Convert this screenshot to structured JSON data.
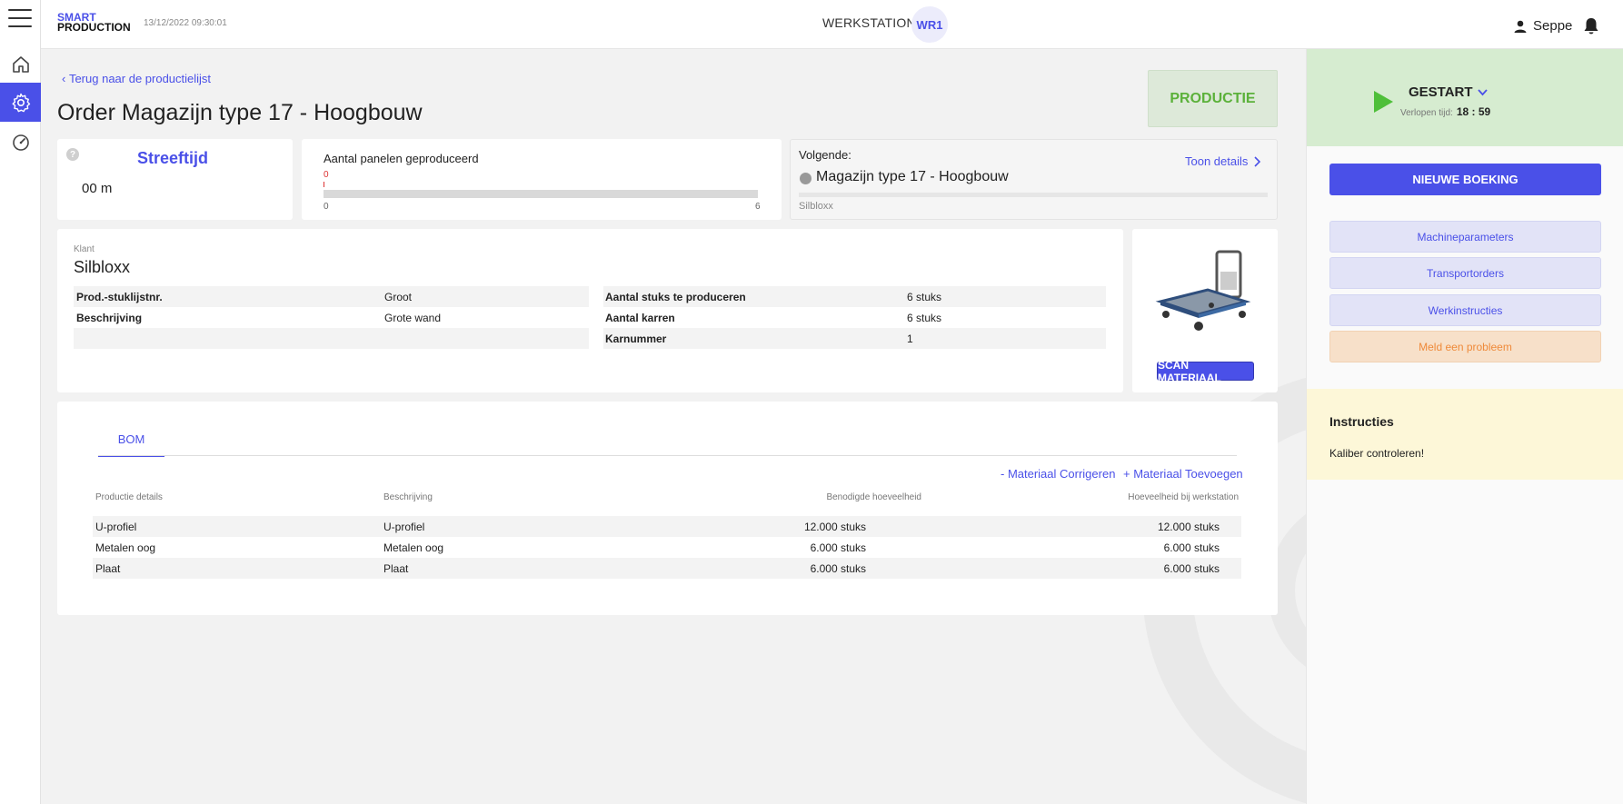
{
  "header": {
    "logo_line1": "SMART",
    "logo_line2": "PRODUCTION",
    "timestamp": "13/12/2022 09:30:01",
    "workstation_label": "WERKSTATION",
    "workstation_code": "WR1",
    "user_name": "Seppe"
  },
  "nav": {
    "items": [
      "home-icon",
      "gear-icon",
      "dashboard-icon"
    ],
    "active": 1
  },
  "main": {
    "back_link": "Terug naar de productielijst",
    "title": "Order Magazijn type 17 - Hoogbouw",
    "status_badge": "PRODUCTIE",
    "streeftijd": {
      "question": "?",
      "label": "Streeftijd",
      "value": "00 m"
    },
    "panels": {
      "label": "Aantal panelen geproduceerd",
      "current": "0",
      "min": "0",
      "max": "6",
      "progress": 0
    },
    "next": {
      "label": "Volgende:",
      "name": "Magazijn type 17 - Hoogbouw",
      "customer": "Silbloxx",
      "details_link": "Toon details"
    },
    "info": {
      "customer_label": "Klant",
      "customer": "Silbloxx",
      "left_rows": [
        {
          "key": "Prod.-stuklijstnr.",
          "value": "Groot"
        },
        {
          "key": "Beschrijving",
          "value": "Grote wand"
        },
        {
          "key": "",
          "value": ""
        }
      ],
      "right_rows": [
        {
          "key": "Aantal stuks te produceren",
          "value": "6 stuks"
        },
        {
          "key": "Aantal karren",
          "value": "6 stuks"
        },
        {
          "key": "Karnummer",
          "value": "1"
        }
      ]
    },
    "scan_button": "SCAN MATERIAAL",
    "bom": {
      "tab": "BOM",
      "action_correct": "- Materiaal Corrigeren",
      "action_add": "+ Materiaal Toevoegen",
      "columns": [
        "Productie details",
        "Beschrijving",
        "Benodigde hoeveelheid",
        "Hoeveelheid bij werkstation"
      ],
      "rows": [
        {
          "detail": "U-profiel",
          "desc": "U-profiel",
          "needed": "12.000 stuks",
          "at_ws": "12.000 stuks"
        },
        {
          "detail": "Metalen oog",
          "desc": "Metalen oog",
          "needed": "6.000 stuks",
          "at_ws": "6.000 stuks"
        },
        {
          "detail": "Plaat",
          "desc": "Plaat",
          "needed": "6.000 stuks",
          "at_ws": "6.000 stuks"
        }
      ]
    }
  },
  "side": {
    "status": "GESTART",
    "elapsed_label": "Verlopen tijd:",
    "elapsed": "18 : 59",
    "new_booking": "NIEUWE BOEKING",
    "buttons": [
      "Machineparameters",
      "Transportorders",
      "Werkinstructies",
      "Meld een probleem"
    ],
    "instructions_title": "Instructies",
    "instructions_text": "Kaliber controleren!"
  },
  "colors": {
    "accent": "#4a50e8",
    "production_green": "#5bb13a",
    "warning_orange": "#ef8a3a"
  }
}
